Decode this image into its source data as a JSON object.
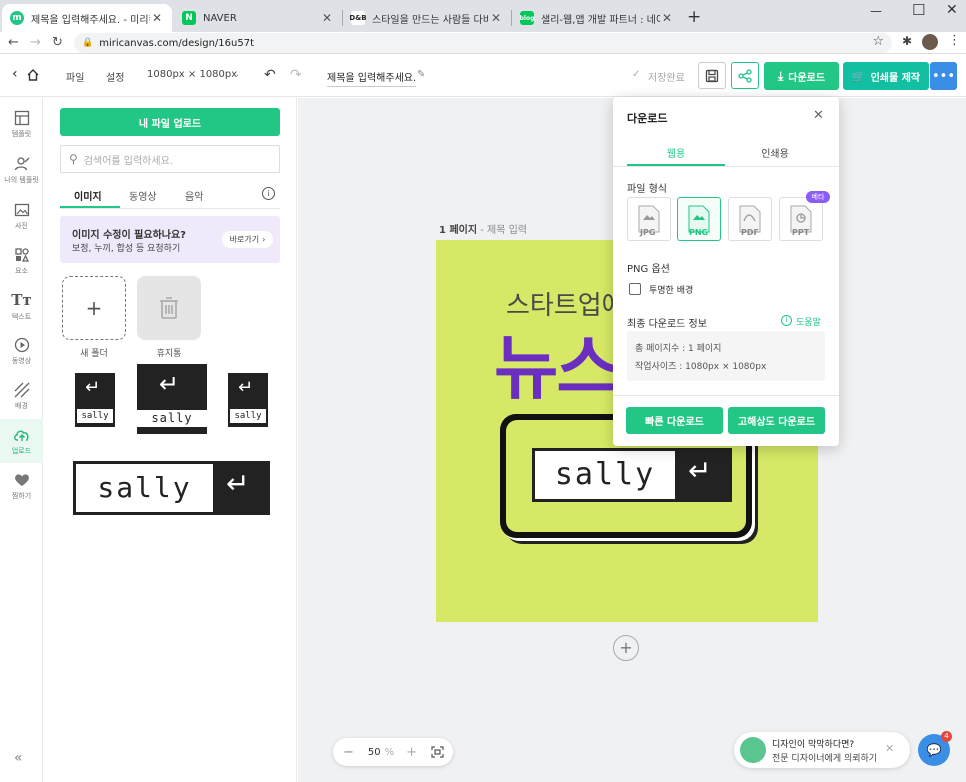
{
  "browser": {
    "tabs": [
      {
        "title": "제목을 입력해주세요. - 미리캔버스",
        "favicon": "m",
        "fav_color": "#22c785"
      },
      {
        "title": "NAVER",
        "favicon": "N",
        "fav_color": "#03c75a"
      },
      {
        "title": "스타일을 만드는 사람들 다비걸",
        "favicon": "D&B",
        "fav_color": "#222222"
      },
      {
        "title": "샐리-웹,앱 개발 파트너 : 네이버",
        "favicon": "blog",
        "fav_color": "#03c75a"
      }
    ],
    "url": "miricanvas.com/design/16u57t"
  },
  "header": {
    "menu_file": "파일",
    "menu_settings": "설정",
    "size": "1080px × 1080px",
    "doc_title": "제목을 입력해주세요.",
    "save_status": "저장완료",
    "download_label": "다운로드",
    "print_label": "인쇄물 제작"
  },
  "rail": [
    {
      "label": "템플릿",
      "icon": "template-icon"
    },
    {
      "label": "나의 템플릿",
      "icon": "my-template-icon"
    },
    {
      "label": "사진",
      "icon": "photo-icon"
    },
    {
      "label": "요소",
      "icon": "elements-icon"
    },
    {
      "label": "텍스트",
      "icon": "text-icon"
    },
    {
      "label": "동영상",
      "icon": "video-icon"
    },
    {
      "label": "배경",
      "icon": "background-icon"
    },
    {
      "label": "업로드",
      "icon": "upload-icon"
    },
    {
      "label": "찜하기",
      "icon": "heart-icon"
    }
  ],
  "panel": {
    "upload_button": "내 파일 업로드",
    "search_placeholder": "검색어를 입력하세요.",
    "tabs": [
      "이미지",
      "동영상",
      "음악"
    ],
    "promo_title": "이미지 수정이 필요하나요?",
    "promo_text": "보정, 누끼, 합성 등 요청하기",
    "promo_button": "바로가기",
    "new_folder": "새 폴더",
    "trash": "휴지통",
    "logo_text": "sally"
  },
  "canvas": {
    "page_label": "1 페이지",
    "page_sub": "- 제목 입력",
    "headline_small": "스타트업에서",
    "headline_big": "뉴스",
    "bg_color": "#d6e865",
    "accent_color": "#6a2ec0",
    "zoom_value": "50",
    "zoom_unit": "%"
  },
  "download": {
    "title": "다운로드",
    "tab_web": "웹용",
    "tab_print": "인쇄용",
    "format_label": "파일 형식",
    "formats": [
      "JPG",
      "PNG",
      "PDF",
      "PPT"
    ],
    "beta_badge": "베타",
    "png_options_label": "PNG 옵션",
    "transparent_label": "투명한 배경",
    "final_info_label": "최종 다운로드 정보",
    "help_label": "도움말",
    "total_pages": "총 페이지수 : 1 페이지",
    "work_size": "작업사이즈 : 1080px × 1080px",
    "quick_download": "빠른 다운로드",
    "hq_download": "고해상도 다운로드"
  },
  "chat": {
    "line1": "디자인이 막막하다면?",
    "line2": "전문 디자이너에게 의뢰하기",
    "badge": "4"
  }
}
